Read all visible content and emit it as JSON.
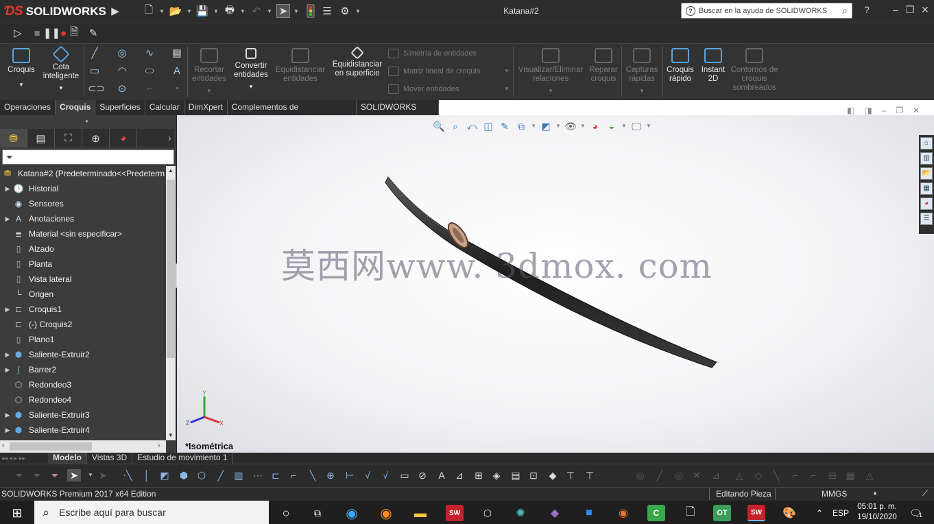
{
  "app": {
    "name": "SOLIDWORKS",
    "document_title": "Katana#2",
    "help_search_placeholder": "Buscar en la ayuda de SOLIDWORKS"
  },
  "ribbon": {
    "buttons": {
      "croquis": "Croquis",
      "cota_inteligente": "Cota inteligente",
      "recortar": "Recortar entidades",
      "convertir": "Convertir entidades",
      "equidistanciar": "Equidistanciar entidades",
      "equidistanciar_sup": "Equidistanciar en superficie",
      "simetria": "Simetría de entidades",
      "matriz": "Matriz lineal de croquis",
      "mover": "Mover entidades",
      "visualizar": "Visualizar/Eliminar relaciones",
      "reparar": "Reparar croquis",
      "capturas": "Capturas rápidas",
      "croquis_rapido": "Croquis rápido",
      "instant2d": "Instant 2D",
      "contornos": "Contornos de croquis sombreados"
    }
  },
  "command_tabs": [
    "Operaciones",
    "Croquis",
    "Superficies",
    "Calcular",
    "DimXpert",
    "Complementos de SOLIDWORKS",
    "SOLIDWORKS MBD"
  ],
  "feature_tree": {
    "root": "Katana#2  (Predeterminado<<Predeterm",
    "items": [
      {
        "label": "Historial",
        "expand": true
      },
      {
        "label": "Sensores",
        "expand": false
      },
      {
        "label": "Anotaciones",
        "expand": true
      },
      {
        "label": "Material <sin especificar>",
        "expand": false
      },
      {
        "label": "Alzado",
        "expand": false
      },
      {
        "label": "Planta",
        "expand": false
      },
      {
        "label": "Vista lateral",
        "expand": false
      },
      {
        "label": "Origen",
        "expand": false
      },
      {
        "label": "Croquis1",
        "expand": true
      },
      {
        "label": "(-) Croquis2",
        "expand": false
      },
      {
        "label": "Plano1",
        "expand": false
      },
      {
        "label": "Saliente-Extruir2",
        "expand": true
      },
      {
        "label": "Barrer2",
        "expand": true
      },
      {
        "label": "Redondeo3",
        "expand": false
      },
      {
        "label": "Redondeo4",
        "expand": false
      },
      {
        "label": "Saliente-Extruir3",
        "expand": true
      },
      {
        "label": "Saliente-Extruir4",
        "expand": true
      }
    ]
  },
  "viewport": {
    "watermark": "莫西网www. 3dmox. com",
    "view_label": "*Isométrica",
    "triad": {
      "x": "X",
      "y": "Y",
      "z": "Z"
    }
  },
  "bottom_tabs": [
    "Modelo",
    "Vistas 3D",
    "Estudio de movimiento 1"
  ],
  "status": {
    "edition": "SOLIDWORKS Premium 2017 x64 Edition",
    "mode": "Editando Pieza",
    "units": "MMGS"
  },
  "taskbar": {
    "search_placeholder": "Escribe aquí para buscar",
    "language": "ESP",
    "time": "05:01 p. m.",
    "date": "19/10/2020",
    "notifications": "1"
  },
  "colors": {
    "accent": "#e2352c",
    "background_dark": "#2b2b2b",
    "ribbon_icon": "#5aa3e0"
  }
}
